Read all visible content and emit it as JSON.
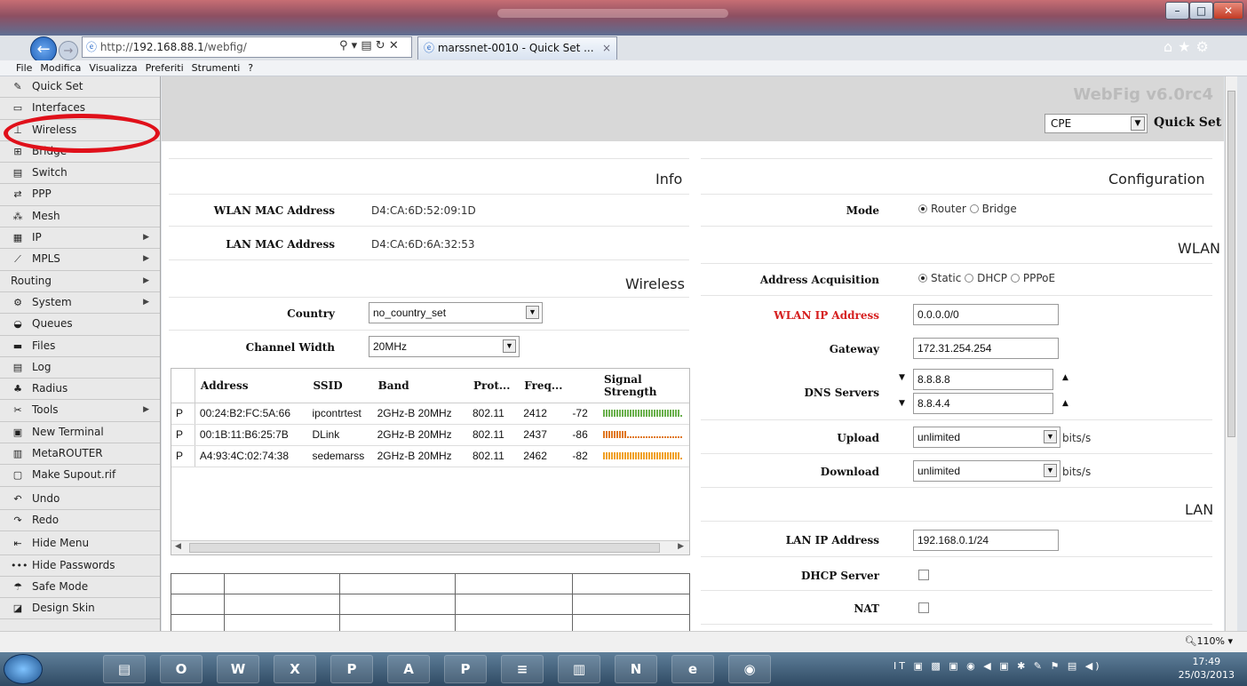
{
  "browser": {
    "url_prefix": "http://",
    "url_host": "192.168.88.1",
    "url_path": "/webfig/",
    "tab_title": "marssnet-0010 - Quick Set ...",
    "menu": [
      "File",
      "Modifica",
      "Visualizza",
      "Preferiti",
      "Strumenti",
      "?"
    ],
    "zoom": "110%"
  },
  "sidebar": [
    {
      "label": "Quick Set",
      "icon": "wand-icon",
      "arrow": false
    },
    {
      "label": "Interfaces",
      "icon": "interfaces-icon",
      "arrow": false
    },
    {
      "label": "Wireless",
      "icon": "antenna-icon",
      "arrow": false
    },
    {
      "label": "Bridge",
      "icon": "bridge-icon",
      "arrow": false
    },
    {
      "label": "Switch",
      "icon": "switch-icon",
      "arrow": false
    },
    {
      "label": "PPP",
      "icon": "ppp-icon",
      "arrow": false
    },
    {
      "label": "Mesh",
      "icon": "mesh-icon",
      "arrow": false
    },
    {
      "label": "IP",
      "icon": "ip-icon",
      "arrow": true
    },
    {
      "label": "MPLS",
      "icon": "mpls-icon",
      "arrow": true
    },
    {
      "label": "Routing",
      "icon": "",
      "arrow": true
    },
    {
      "label": "System",
      "icon": "gear-icon",
      "arrow": true
    },
    {
      "label": "Queues",
      "icon": "queues-icon",
      "arrow": false
    },
    {
      "label": "Files",
      "icon": "folder-icon",
      "arrow": false
    },
    {
      "label": "Log",
      "icon": "log-icon",
      "arrow": false
    },
    {
      "label": "Radius",
      "icon": "radius-icon",
      "arrow": false
    },
    {
      "label": "Tools",
      "icon": "tools-icon",
      "arrow": true
    },
    {
      "label": "New Terminal",
      "icon": "terminal-icon",
      "arrow": false
    },
    {
      "label": "MetaROUTER",
      "icon": "metarouter-icon",
      "arrow": false
    },
    {
      "label": "Make Supout.rif",
      "icon": "file-icon",
      "arrow": false
    },
    {
      "label": "Undo",
      "icon": "undo-icon",
      "arrow": false
    },
    {
      "label": "Redo",
      "icon": "redo-icon",
      "arrow": false
    },
    {
      "label": "Hide Menu",
      "icon": "hide-menu-icon",
      "arrow": false
    },
    {
      "label": "Hide Passwords",
      "icon": "password-icon",
      "arrow": false
    },
    {
      "label": "Safe Mode",
      "icon": "umbrella-icon",
      "arrow": false
    },
    {
      "label": "Design Skin",
      "icon": "skin-icon",
      "arrow": false
    }
  ],
  "header": {
    "brand": "WebFig v6.0rc4",
    "mode_value": "CPE",
    "quick_set": "Quick Set"
  },
  "info": {
    "title": "Info",
    "wlan_mac_label": "WLAN MAC Address",
    "wlan_mac": "D4:CA:6D:52:09:1D",
    "lan_mac_label": "LAN MAC Address",
    "lan_mac": "D4:CA:6D:6A:32:53"
  },
  "wireless": {
    "title": "Wireless",
    "country_label": "Country",
    "country": "no_country_set",
    "channel_label": "Channel Width",
    "channel": "20MHz",
    "columns": [
      "Address",
      "SSID",
      "Band",
      "Prot...",
      "Freq...",
      "",
      "Signal Strength"
    ],
    "rows": [
      {
        "flag": "P",
        "address": "00:24:B2:FC:5A:66",
        "ssid": "ipcontrtest",
        "band": "2GHz-B 20MHz",
        "proto": "802.11",
        "freq": "2412",
        "signal": "-72",
        "strength": 0.95,
        "color": "#6ab04c"
      },
      {
        "flag": "P",
        "address": "00:1B:11:B6:25:7B",
        "ssid": "DLink",
        "band": "2GHz-B 20MHz",
        "proto": "802.11",
        "freq": "2437",
        "signal": "-86",
        "strength": 0.3,
        "color": "#e0781f"
      },
      {
        "flag": "P",
        "address": "A4:93:4C:02:74:38",
        "ssid": "sedemarss",
        "band": "2GHz-B 20MHz",
        "proto": "802.11",
        "freq": "2462",
        "signal": "-82",
        "strength": 0.95,
        "color": "#f0a020"
      }
    ]
  },
  "config": {
    "title": "Configuration",
    "mode_label": "Mode",
    "mode_opts": [
      "Router",
      "Bridge"
    ],
    "mode_selected": 0,
    "wlan_title": "WLAN",
    "acq_label": "Address Acquisition",
    "acq_opts": [
      "Static",
      "DHCP",
      "PPPoE"
    ],
    "acq_selected": 0,
    "wlan_ip_label": "WLAN IP Address",
    "wlan_ip": "0.0.0.0/0",
    "gateway_label": "Gateway",
    "gateway": "172.31.254.254",
    "dns_label": "DNS Servers",
    "dns1": "8.8.8.8",
    "dns2": "8.8.4.4",
    "upload_label": "Upload",
    "upload": "unlimited",
    "download_label": "Download",
    "download": "unlimited",
    "unit": "bits/s",
    "lan_title": "LAN",
    "lan_ip_label": "LAN IP Address",
    "lan_ip": "192.168.0.1/24",
    "dhcp_label": "DHCP Server",
    "nat_label": "NAT"
  },
  "taskbar": {
    "lang": "IT",
    "time": "17:49",
    "date": "25/03/2013",
    "apps": [
      "explorer-icon",
      "outlook-icon",
      "word-icon",
      "excel-icon",
      "powerpoint-icon",
      "access-icon",
      "publisher-icon",
      "winrar-icon",
      "notes-icon",
      "onenote-icon",
      "ie-icon",
      "firefox-icon"
    ]
  }
}
